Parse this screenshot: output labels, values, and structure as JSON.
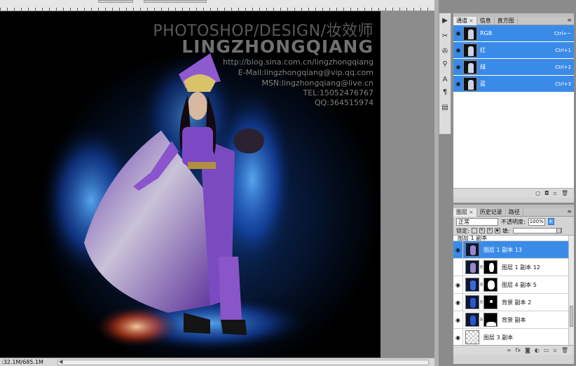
{
  "watermark": {
    "title": "PHOTOSHOP/DESIGN/妆效师",
    "name": "LINGZHONGQIANG",
    "lines": [
      "http://blog.sina.com.cn/lingzhongqiang",
      "E-Mail:lingzhongqiang@vip.qq.com",
      "MSN:lingzhongqiang@live.cn",
      "TEL:15052476767",
      "QQ:364515974"
    ]
  },
  "status": {
    "doc_size": ":32.1M/685.1M"
  },
  "toolbar": {
    "icons": [
      "play-icon",
      "tools-icon",
      "clone-source-icon",
      "stamp-icon",
      "character-icon",
      "paragraph-icon",
      "layer-comps-icon"
    ]
  },
  "channels_panel": {
    "tabs": [
      {
        "label": "通道",
        "active": true,
        "closable": true
      },
      {
        "label": "信息",
        "active": false,
        "closable": false
      },
      {
        "label": "直方图",
        "active": false,
        "closable": false
      }
    ],
    "channels": [
      {
        "name": "RGB",
        "shortcut": "Ctrl+~"
      },
      {
        "name": "红",
        "shortcut": "Ctrl+1"
      },
      {
        "name": "绿",
        "shortcut": "Ctrl+2"
      },
      {
        "name": "蓝",
        "shortcut": "Ctrl+3"
      }
    ]
  },
  "layers_panel": {
    "tabs": [
      {
        "label": "图层",
        "active": true,
        "closable": true
      },
      {
        "label": "历史记录",
        "active": false,
        "closable": false
      },
      {
        "label": "路径",
        "active": false,
        "closable": false
      }
    ],
    "blend_mode": "正常",
    "opacity_label": "不透明度:",
    "opacity_value": "100%",
    "lock_label": "锁定:",
    "fill_label": "填:",
    "partial_layer": "图层 1 副本",
    "layers": [
      {
        "name": "图层 1 副本 13",
        "selected": true,
        "visible": true,
        "mask": false,
        "thumb": "figure"
      },
      {
        "name": "图层 1 副本 12",
        "selected": false,
        "visible": false,
        "mask": true,
        "thumb": "figure"
      },
      {
        "name": "图层 4 副本 5",
        "selected": false,
        "visible": true,
        "mask": true,
        "thumb": "dark"
      },
      {
        "name": "背景 副本 2",
        "selected": false,
        "visible": true,
        "mask": true,
        "thumb": "dark"
      },
      {
        "name": "背景 副本",
        "selected": false,
        "visible": true,
        "mask": true,
        "thumb": "dark"
      },
      {
        "name": "图层 3 副本",
        "selected": false,
        "visible": true,
        "mask": false,
        "thumb": "checker"
      }
    ]
  },
  "colors": {
    "selection": "#3a8be8",
    "panel_bg": "#d4d4d4"
  }
}
